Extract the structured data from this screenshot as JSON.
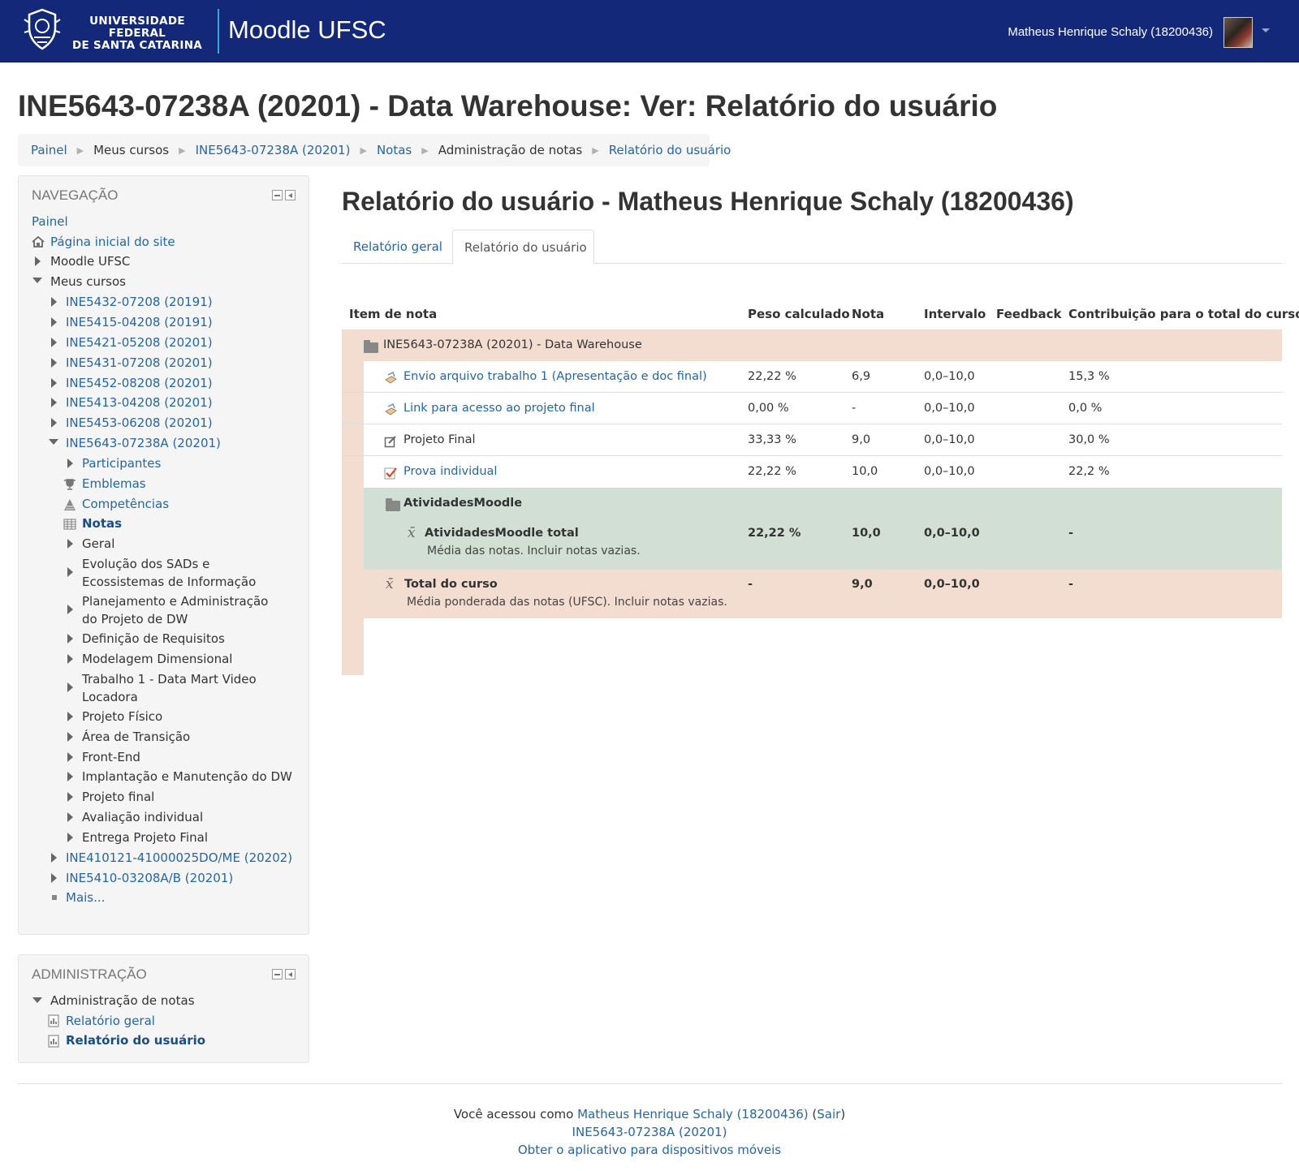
{
  "header": {
    "university_line1": "UNIVERSIDADE FEDERAL",
    "university_line2": "DE SANTA CATARINA",
    "brand": "Moodle UFSC",
    "user_name": "Matheus Henrique Schaly (18200436)"
  },
  "page_title": "INE5643-07238A (20201) - Data Warehouse: Ver: Relatório do usuário",
  "breadcrumb": [
    "Painel",
    "Meus cursos",
    "INE5643-07238A (20201)",
    "Notas",
    "Administração de notas",
    "Relatório do usuário"
  ],
  "navigation": {
    "title": "NAVEGAÇÃO",
    "painel": "Painel",
    "home": "Página inicial do site",
    "moodle_ufsc": "Moodle UFSC",
    "my_courses": "Meus cursos",
    "courses": [
      "INE5432-07208 (20191)",
      "INE5415-04208 (20191)",
      "INE5421-05208 (20201)",
      "INE5431-07208 (20201)",
      "INE5452-08208 (20201)",
      "INE5413-04208 (20201)",
      "INE5453-06208 (20201)"
    ],
    "current_course": "INE5643-07238A (20201)",
    "course_items": [
      "Participantes",
      "Emblemas",
      "Competências",
      "Notas"
    ],
    "sections": [
      "Geral",
      "Evolução dos SADs e Ecossistemas de Informação",
      "Planejamento e Administração do Projeto de DW",
      "Definição de Requisitos",
      "Modelagem Dimensional",
      "Trabalho 1 - Data Mart Video Locadora",
      "Projeto Físico",
      "Área de Transição",
      "Front-End",
      "Implantação e Manutenção do DW",
      "Projeto final",
      "Avaliação individual",
      "Entrega Projeto Final"
    ],
    "more_courses": [
      "INE410121-41000025DO/ME (20202)",
      "INE5410-03208A/B (20201)"
    ],
    "more": "Mais..."
  },
  "administration": {
    "title": "ADMINISTRAÇÃO",
    "group": "Administração de notas",
    "items": [
      "Relatório geral",
      "Relatório do usuário"
    ]
  },
  "main": {
    "title": "Relatório do usuário - Matheus Henrique Schaly (18200436)",
    "tabs": [
      "Relatório geral",
      "Relatório do usuário"
    ],
    "columns": [
      "Item de nota",
      "Peso calculado",
      "Nota",
      "Intervalo",
      "Feedback",
      "Contribuição para o total do curso"
    ],
    "course_category": "INE5643-07238A (20201) - Data Warehouse",
    "rows": [
      {
        "name": "Envio arquivo trabalho 1 (Apresentação e doc final)",
        "weight": "22,22 %",
        "grade": "6,9",
        "range": "0,0–10,0",
        "contribution": "15,3 %",
        "icon": "assignment-icon"
      },
      {
        "name": "Link para acesso ao projeto final",
        "weight": "0,00 %",
        "grade": "-",
        "range": "0,0–10,0",
        "contribution": "0,0 %",
        "icon": "assignment-icon"
      },
      {
        "name": "Projeto Final",
        "weight": "33,33 %",
        "grade": "9,0",
        "range": "0,0–10,0",
        "contribution": "30,0 %",
        "icon": "manual-item-icon"
      },
      {
        "name": "Prova individual",
        "weight": "22,22 %",
        "grade": "10,0",
        "range": "0,0–10,0",
        "contribution": "22,2 %",
        "icon": "quiz-icon"
      }
    ],
    "subcategory": {
      "name": "AtividadesMoodle",
      "total_name": "AtividadesMoodle total",
      "total_desc": "Média das notas. Incluir notas vazias.",
      "weight": "22,22 %",
      "grade": "10,0",
      "range": "0,0–10,0",
      "contribution": "-"
    },
    "course_total": {
      "name": "Total do curso",
      "desc": "Média ponderada das notas (UFSC). Incluir notas vazias.",
      "weight": "-",
      "grade": "9,0",
      "range": "0,0–10,0",
      "contribution": "-"
    }
  },
  "footer": {
    "logged_prefix": "Você acessou como",
    "user_link": "Matheus Henrique Schaly (18200436)",
    "logout": "Sair",
    "course_link": "INE5643-07238A (20201)",
    "app_link": "Obter o aplicativo para dispositivos móveis"
  },
  "colors": {
    "header_bg": "#14287a",
    "link": "#2565a4",
    "category_bg": "#f2ddd0",
    "subcategory_bg": "#d2dfd5"
  }
}
